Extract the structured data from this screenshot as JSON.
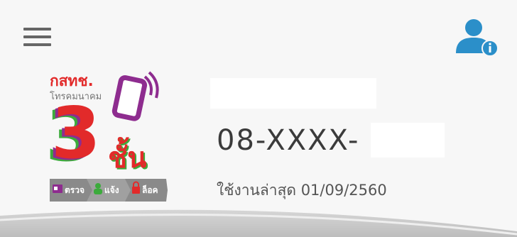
{
  "header": {
    "menu_icon": "hamburger-menu-icon",
    "user_icon": "user-info-icon",
    "colors": {
      "menu": "#666666",
      "user": "#1e90c8",
      "info_badge": "#1e90c8"
    }
  },
  "logo": {
    "agency": "กสทช.",
    "subtitle": "โทรคมนาคม",
    "number": "3",
    "word": "ชั้น",
    "steps": [
      "ตรวจ",
      "แจ้ง",
      "ล็อค"
    ],
    "icons": [
      "phone-icon",
      "id-card-icon",
      "person-icon",
      "lock-icon"
    ],
    "colors": {
      "red": "#e22a2a",
      "green": "#3cab3c",
      "purple": "#8e2c8f",
      "gray": "#8a8a8a"
    }
  },
  "account": {
    "phone": "08-XXXX-",
    "last_used": "ใช้งานล่าสุด 01/09/2560"
  }
}
